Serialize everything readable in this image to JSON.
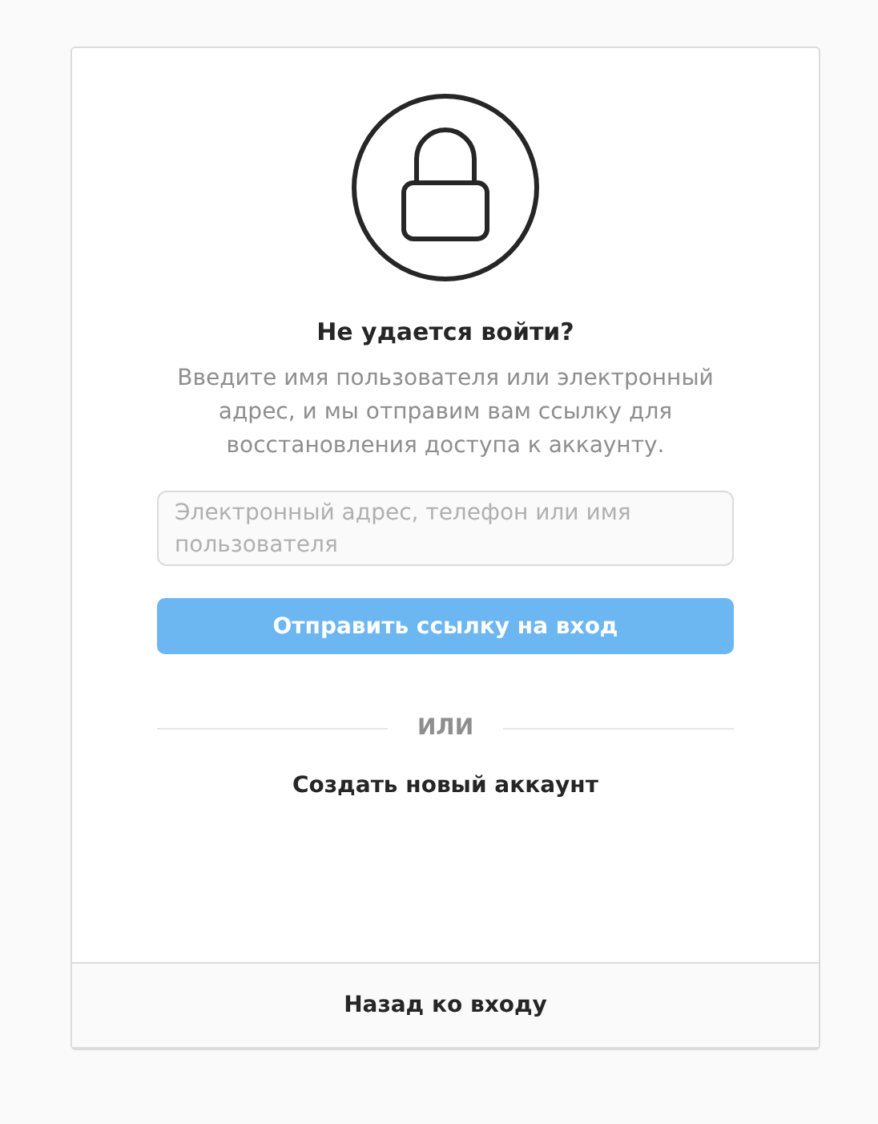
{
  "heading": "Не удается войти?",
  "description": "Введите имя пользователя или электронный адрес, и мы отправим вам ссылку для восстановления доступа к аккаунту.",
  "login_field": {
    "placeholder": "Электронный адрес, телефон или имя пользователя"
  },
  "send_button": {
    "label": "Отправить ссылку на вход",
    "disabled": true
  },
  "divider": "ИЛИ",
  "create_account_link": "Создать новый аккаунт",
  "back_link": "Назад ко входу"
}
